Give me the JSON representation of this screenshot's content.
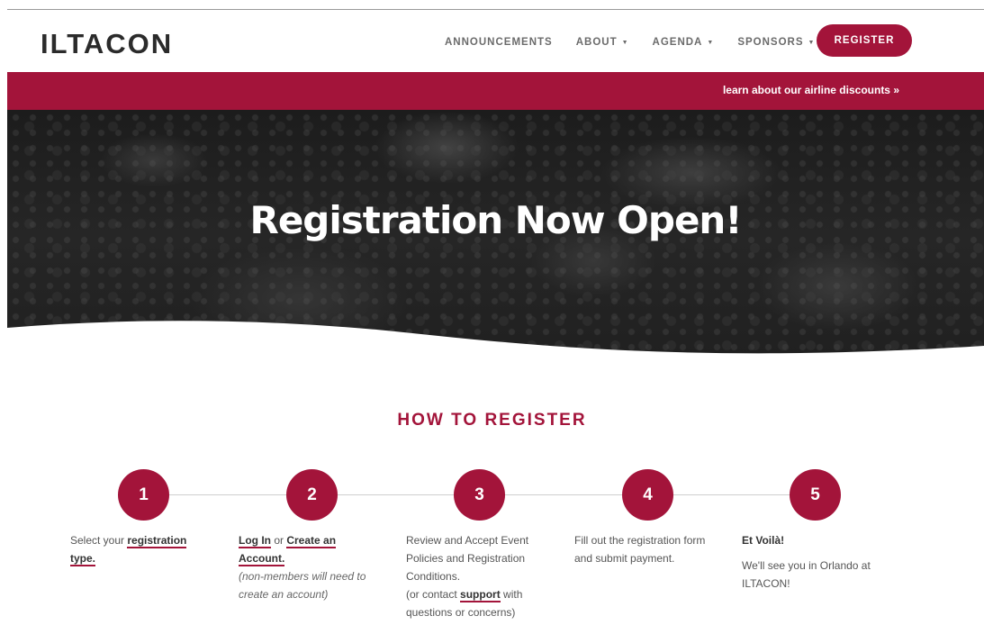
{
  "header": {
    "logo": "ILTACON",
    "nav": [
      {
        "label": "ANNOUNCEMENTS",
        "dropdown": false
      },
      {
        "label": "ABOUT",
        "dropdown": true
      },
      {
        "label": "AGENDA",
        "dropdown": true
      },
      {
        "label": "SPONSORS",
        "dropdown": true
      }
    ],
    "register_label": "REGISTER",
    "caret": "▼"
  },
  "banner": {
    "link": "learn about our airline discounts »"
  },
  "hero": {
    "title": "Registration Now Open!"
  },
  "how_to": {
    "title": "HOW TO REGISTER",
    "steps": [
      {
        "number": "1",
        "text_before": "Select your ",
        "link": "registration",
        "link2": "type."
      },
      {
        "number": "2",
        "link_login": "Log In",
        "or": " or ",
        "link_create": "Create an",
        "link_create2": "Account.",
        "note1": "(non-members will need to",
        "note2": "create an account)"
      },
      {
        "number": "3",
        "line1": "Review and Accept Event",
        "line2": "Policies and Registration",
        "line3": "Conditions.",
        "line4_before": "(or contact ",
        "link": "support",
        "line4_after": " with",
        "line5": "questions or concerns)"
      },
      {
        "number": "4",
        "line1": "Fill out the registration form",
        "line2": "and submit payment."
      },
      {
        "number": "5",
        "heading": "Et Voilà!",
        "line1": "We'll see you in Orlando at",
        "line2": "ILTACON!"
      }
    ]
  },
  "colors": {
    "accent": "#a3143a",
    "nav_text": "#6b6b6b",
    "hero_bg": "#222222"
  }
}
